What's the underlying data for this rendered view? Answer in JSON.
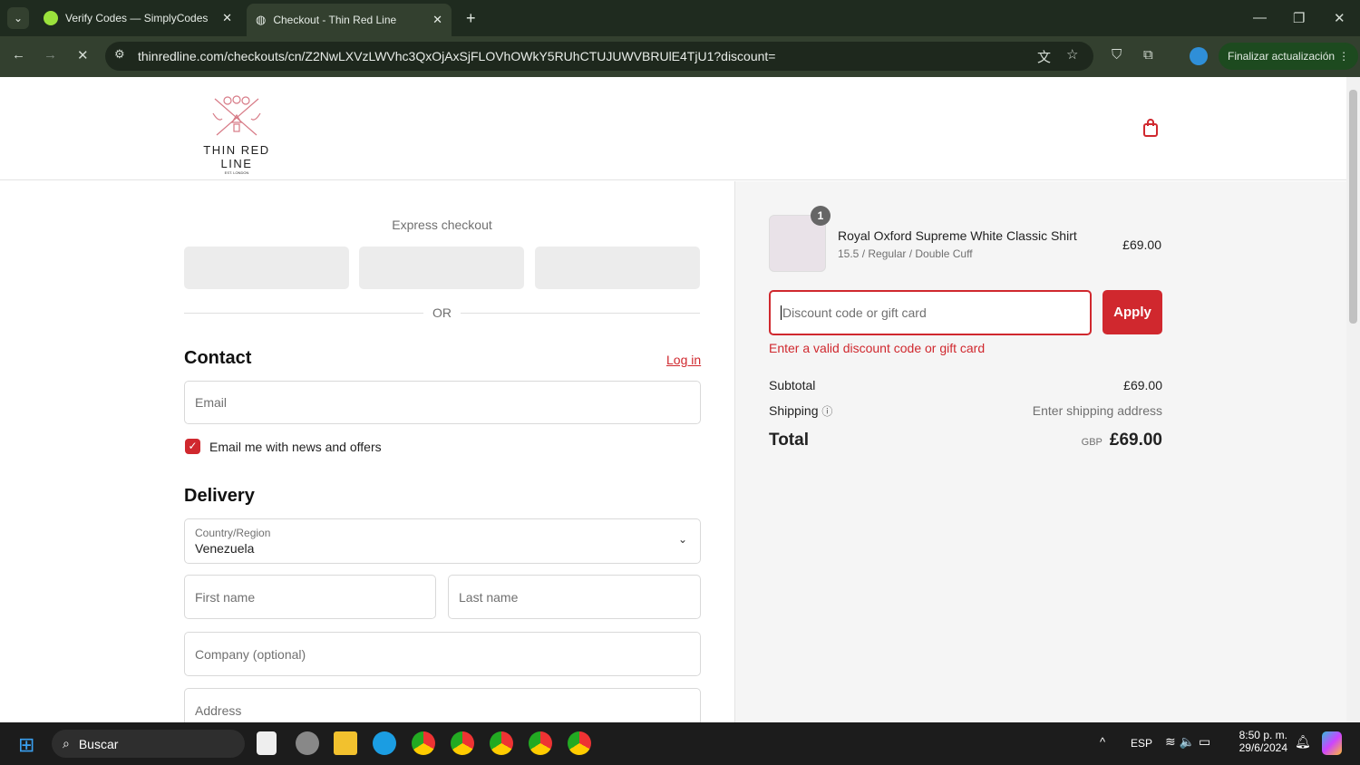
{
  "browser": {
    "tabs": [
      {
        "title": "Verify Codes — SimplyCodes",
        "active": false
      },
      {
        "title": "Checkout - Thin Red Line",
        "active": true
      }
    ],
    "url": "thinredline.com/checkouts/cn/Z2NwLXVzLWVhc3QxOjAxSjFLOVhOWkY5RUhCTUJUWVBRUlE4TjU1?discount=",
    "update_label": "Finalizar actualización"
  },
  "brand": {
    "name": "THIN RED LINE",
    "tagline": "EST. LONDON",
    "accent": "#d0282e"
  },
  "checkout": {
    "express_label": "Express checkout",
    "or_label": "OR",
    "contact": {
      "title": "Contact",
      "login": "Log in",
      "email_placeholder": "Email",
      "newsletter_label": "Email me with news and offers",
      "newsletter_checked": true
    },
    "delivery": {
      "title": "Delivery",
      "country_label": "Country/Region",
      "country_value": "Venezuela",
      "first_name": "First name",
      "last_name": "Last name",
      "company": "Company (optional)",
      "address": "Address"
    }
  },
  "summary": {
    "item": {
      "name": "Royal Oxford Supreme White Classic Shirt",
      "variant": "15.5 / Regular / Double Cuff",
      "price": "£69.00",
      "quantity": "1"
    },
    "discount_placeholder": "Discount code or gift card",
    "apply_label": "Apply",
    "error": "Enter a valid discount code or gift card",
    "subtotal_label": "Subtotal",
    "subtotal": "£69.00",
    "shipping_label": "Shipping",
    "shipping": "Enter shipping address",
    "total_label": "Total",
    "currency": "GBP",
    "total": "£69.00"
  },
  "taskbar": {
    "search": "Buscar",
    "lang": "ESP",
    "time": "8:50 p. m.",
    "date": "29/6/2024"
  }
}
